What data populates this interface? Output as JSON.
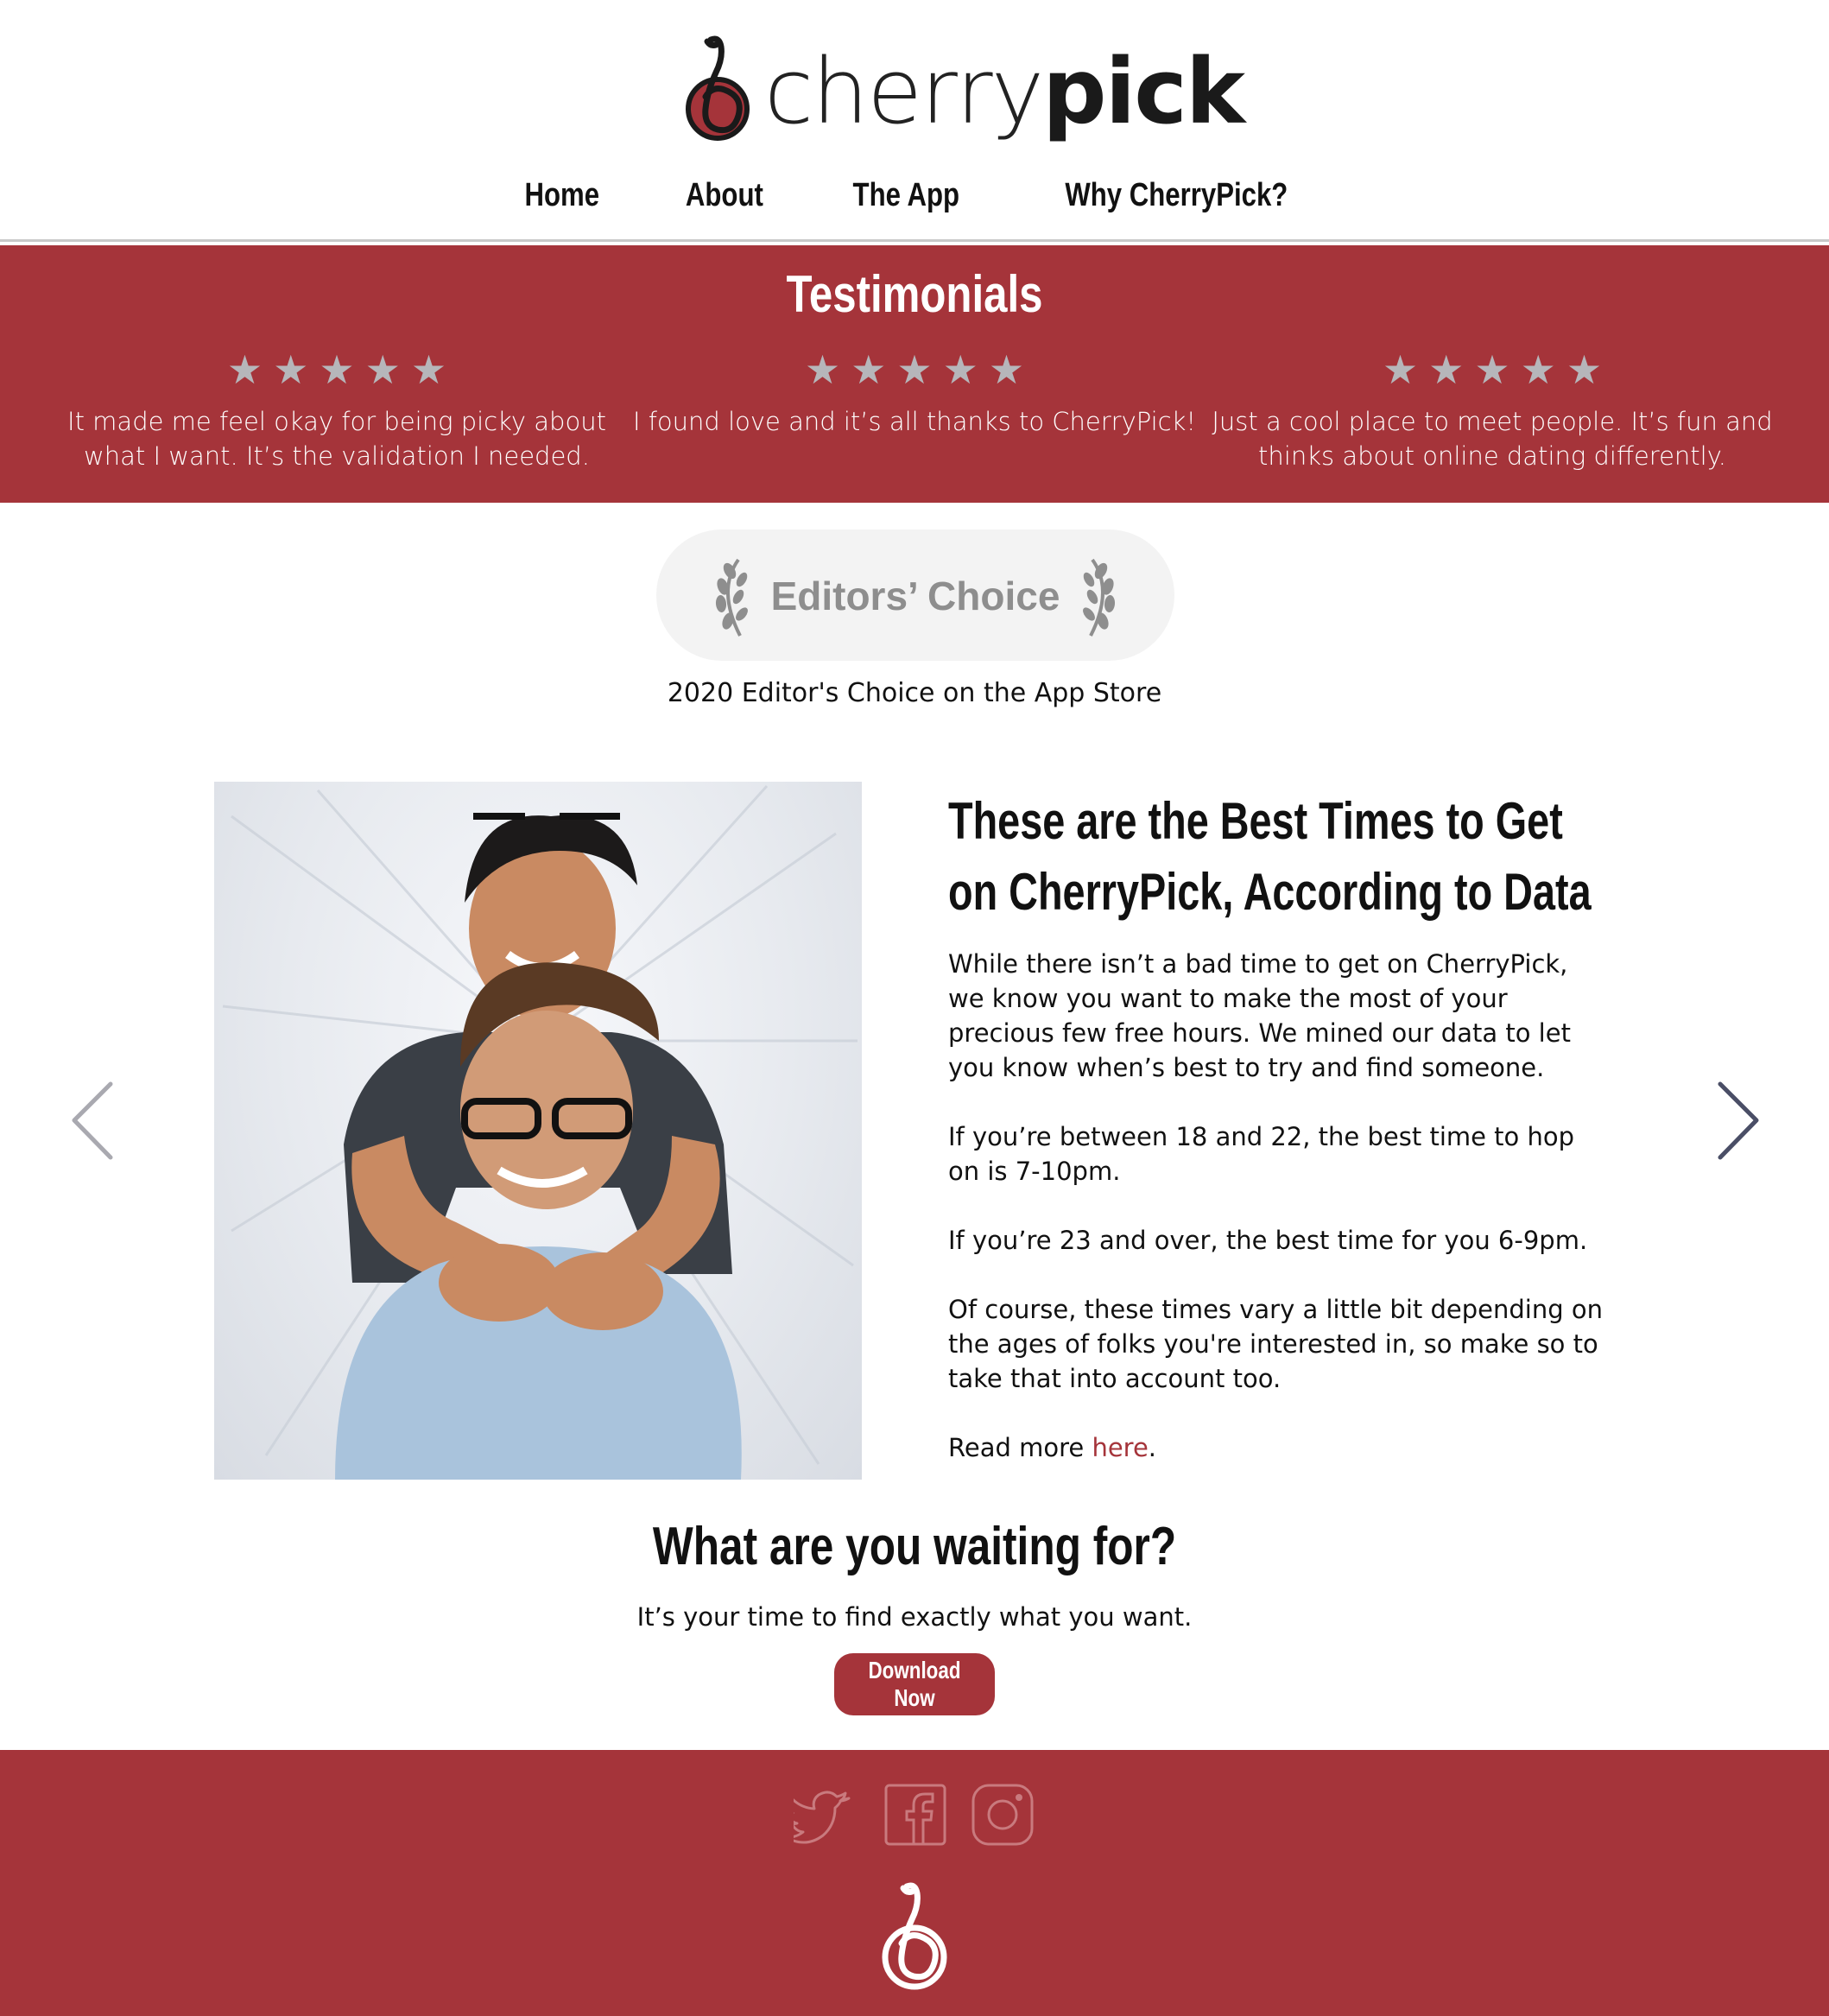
{
  "brand": {
    "name_part1": "cherry",
    "name_part2": "pick",
    "accent_color": "#a5343a",
    "logo_icon": "cherry-logo-icon"
  },
  "nav": {
    "items": [
      {
        "label": "Home"
      },
      {
        "label": "About"
      },
      {
        "label": "The App"
      },
      {
        "label": "Why CherryPick?"
      }
    ]
  },
  "testimonials": {
    "title": "Testimonials",
    "star_icon": "star-icon",
    "items": [
      {
        "rating": 5,
        "text": "It made me feel okay for being picky about what I want. It’s the validation I needed."
      },
      {
        "rating": 5,
        "text": "I found love and it’s all thanks to CherryPick!"
      },
      {
        "rating": 5,
        "text": "Just a cool place to meet people. It’s fun and thinks about online dating differently."
      }
    ]
  },
  "award": {
    "badge_label": "Editors’ Choice",
    "caption": "2020 Editor's Choice on the App Store",
    "laurel_icon": "laurel-icon"
  },
  "carousel": {
    "prev_icon": "chevron-left-icon",
    "next_icon": "chevron-right-icon",
    "slide": {
      "image": "couple-photo",
      "title": "These are the Best Times to Get on CherryPick, According to Data",
      "paragraphs": [
        "While there isn’t a bad time to get on CherryPick, we know you want to make the most of your precious few free hours. We mined our data to let you know when’s best to try and find someone.",
        "If you’re between 18 and 22, the best time to hop on is 7-10pm.",
        "If you’re 23 and over, the best time for you 6-9pm.",
        "Of course, these times vary a little bit depending on the ages of folks you're interested in, so make so to take that into account too."
      ],
      "read_more_prefix": "Read more ",
      "read_more_link": "here",
      "read_more_suffix": "."
    }
  },
  "cta": {
    "title": "What are you waiting for?",
    "subtitle": "It’s your time to find exactly what you want.",
    "button_label": "Download Now"
  },
  "footer": {
    "social": [
      "twitter-icon",
      "facebook-icon",
      "instagram-icon"
    ],
    "logo_icon": "cherry-logo-icon"
  }
}
